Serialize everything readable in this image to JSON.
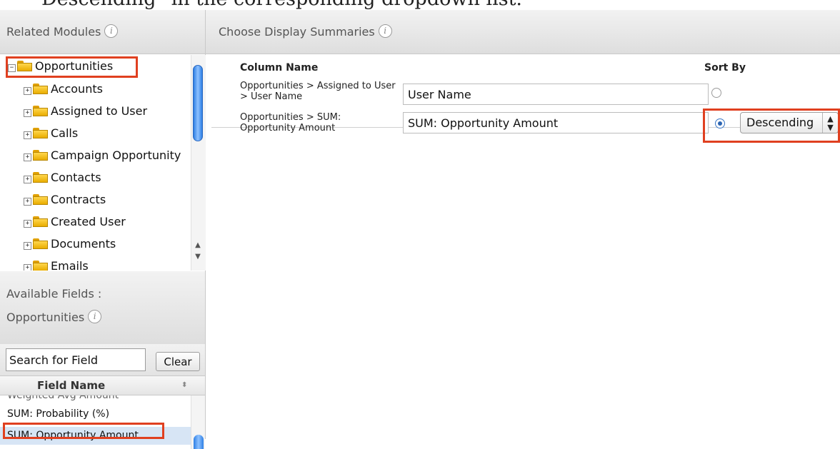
{
  "caption": "Descending\" in the corresponding dropdown list.",
  "related_modules": {
    "title": "Related Modules",
    "info_icon": "info-icon",
    "items": [
      {
        "label": "Opportunities",
        "expanded": true
      },
      {
        "label": "Accounts"
      },
      {
        "label": "Assigned to User"
      },
      {
        "label": "Calls"
      },
      {
        "label": "Campaign Opportunity"
      },
      {
        "label": "Contacts"
      },
      {
        "label": "Contracts"
      },
      {
        "label": "Created User"
      },
      {
        "label": "Documents"
      },
      {
        "label": "Emails"
      }
    ]
  },
  "available_fields": {
    "title_line1": "Available Fields :",
    "title_line2": "Opportunities",
    "search_placeholder": "Search for Field",
    "clear_label": "Clear",
    "column_header": "Field Name",
    "rows": [
      "Weighted Avg Amount",
      "SUM: Probability (%)",
      "SUM: Opportunity Amount"
    ]
  },
  "display_summaries": {
    "title": "Choose Display Summaries",
    "column_name_header": "Column Name",
    "sort_by_header": "Sort By",
    "rows": [
      {
        "label": "Opportunities > Assigned to User > User Name",
        "value": "User Name",
        "sort_selected": false
      },
      {
        "label": "Opportunities > SUM: Opportunity Amount",
        "value": "SUM: Opportunity Amount",
        "sort_selected": true,
        "sort_order": "Descending"
      }
    ]
  },
  "colors": {
    "highlight": "#e04020",
    "selection": "#d7e5f5",
    "scroll_thumb": "#2d7fe4"
  }
}
